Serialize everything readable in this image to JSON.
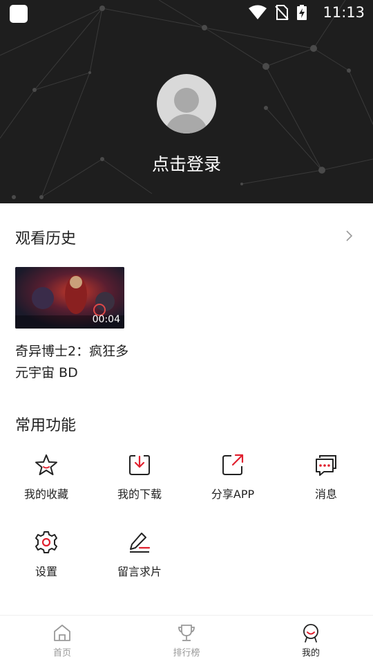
{
  "status_bar": {
    "time": "11:13"
  },
  "header": {
    "login_text": "点击登录"
  },
  "history": {
    "title": "观看历史",
    "items": [
      {
        "title": "奇异博士2：疯狂多元宇宙 BD",
        "duration": "00:04"
      }
    ]
  },
  "features": {
    "title": "常用功能",
    "items": [
      {
        "label": "我的收藏",
        "icon": "star-icon"
      },
      {
        "label": "我的下载",
        "icon": "download-icon"
      },
      {
        "label": "分享APP",
        "icon": "share-icon"
      },
      {
        "label": "消息",
        "icon": "message-icon"
      },
      {
        "label": "设置",
        "icon": "gear-icon"
      },
      {
        "label": "留言求片",
        "icon": "edit-icon"
      }
    ]
  },
  "bottom_nav": {
    "tabs": [
      {
        "label": "首页",
        "icon": "home-icon"
      },
      {
        "label": "排行榜",
        "icon": "trophy-icon"
      },
      {
        "label": "我的",
        "icon": "profile-icon",
        "active": true
      }
    ]
  },
  "colors": {
    "accent": "#e0202e",
    "header_bg": "#1e1e1e"
  }
}
